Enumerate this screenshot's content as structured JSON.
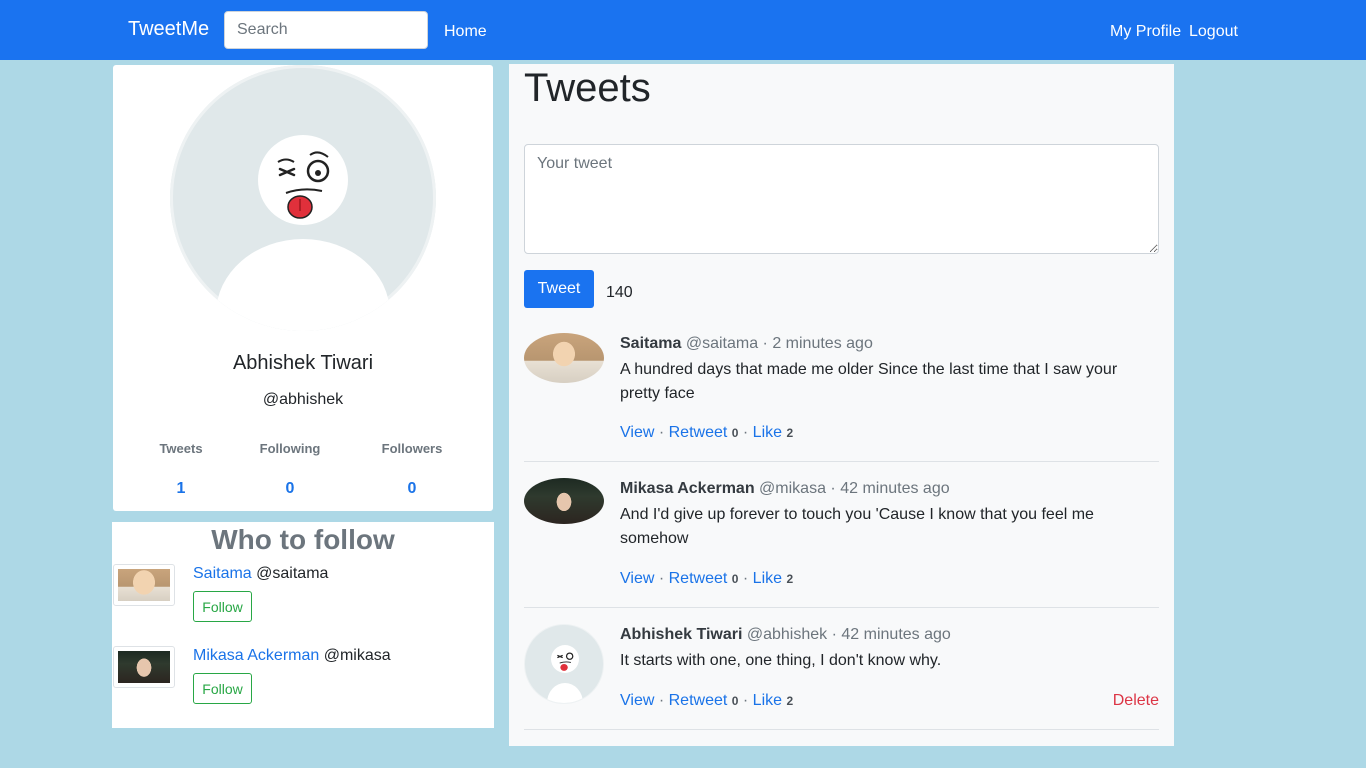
{
  "navbar": {
    "brand": "TweetMe",
    "search_placeholder": "Search",
    "home": "Home",
    "my_profile": "My Profile",
    "logout": "Logout"
  },
  "profile": {
    "name": "Abhishek Tiwari",
    "handle": "@abhishek",
    "stats": [
      {
        "label": "Tweets",
        "value": "1"
      },
      {
        "label": "Following",
        "value": "0"
      },
      {
        "label": "Followers",
        "value": "0"
      }
    ]
  },
  "who_to_follow": {
    "title": "Who to follow",
    "users": [
      {
        "name": "Saitama",
        "handle": "@saitama",
        "button": "Follow"
      },
      {
        "name": "Mikasa Ackerman",
        "handle": "@mikasa",
        "button": "Follow"
      }
    ]
  },
  "tweets": {
    "title": "Tweets",
    "compose_placeholder": "Your tweet",
    "tweet_button": "Tweet",
    "char_count": "140",
    "items": [
      {
        "author": "Saitama",
        "handle": "@saitama",
        "time": "2 minutes ago",
        "text": "A hundred days that made me older Since the last time that I saw your pretty face",
        "view": "View",
        "retweet": "Retweet",
        "retweet_count": "0",
        "like": "Like",
        "like_count": "2"
      },
      {
        "author": "Mikasa Ackerman",
        "handle": "@mikasa",
        "time": "42 minutes ago",
        "text": "And I'd give up forever to touch you 'Cause I know that you feel me somehow",
        "view": "View",
        "retweet": "Retweet",
        "retweet_count": "0",
        "like": "Like",
        "like_count": "2"
      },
      {
        "author": "Abhishek Tiwari",
        "handle": "@abhishek",
        "time": "42 minutes ago",
        "text": "It starts with one, one thing, I don't know why.",
        "view": "View",
        "retweet": "Retweet",
        "retweet_count": "0",
        "like": "Like",
        "like_count": "2",
        "delete": "Delete"
      }
    ]
  },
  "colors": {
    "navbar": "#1a73f0",
    "page_background": "#add8e6",
    "link": "#1a73e8",
    "follow_green": "#28a745",
    "delete_red": "#dc3545"
  }
}
